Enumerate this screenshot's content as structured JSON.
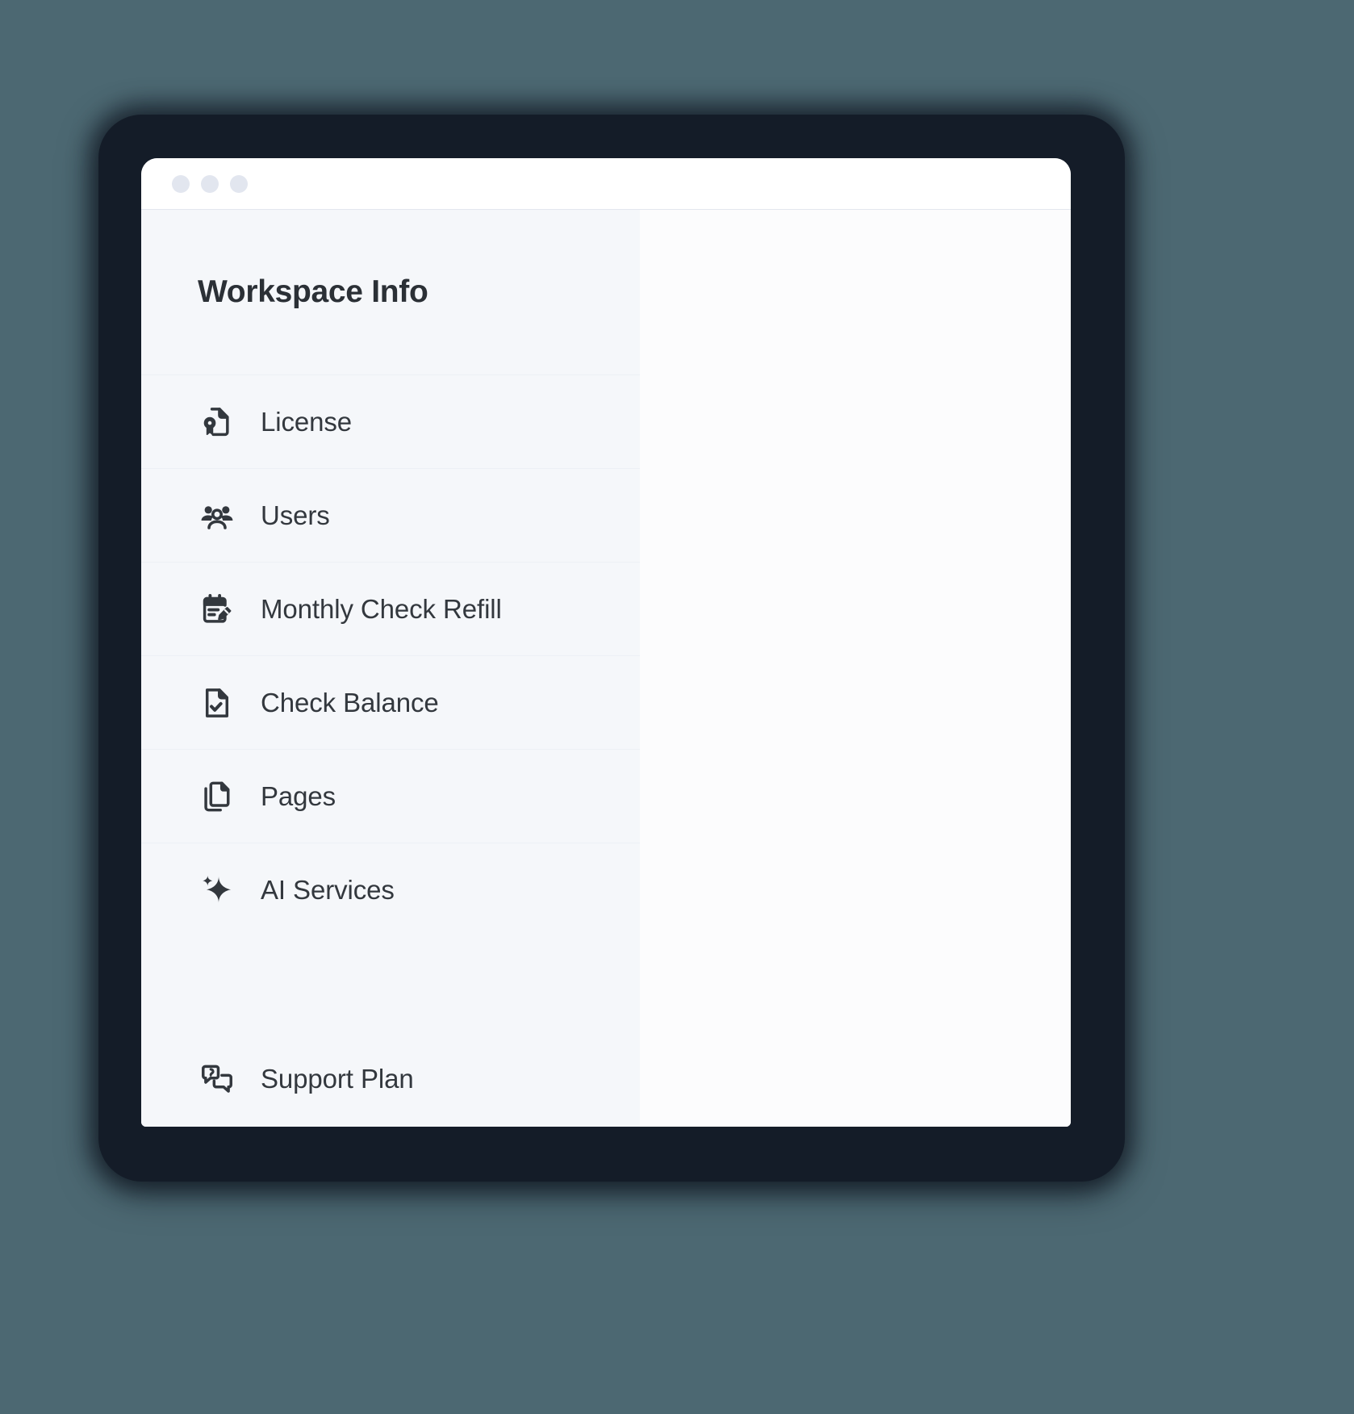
{
  "background_color": "#4C6872",
  "window": {
    "titlebar": {
      "traffic_lights": [
        {
          "name": "close",
          "color": "#E2E6EF"
        },
        {
          "name": "minimize",
          "color": "#E2E6EF"
        },
        {
          "name": "maximize",
          "color": "#E2E6EF"
        }
      ]
    },
    "sidebar": {
      "background_color": "#F5F7FA",
      "title": "Workspace Info",
      "items": [
        {
          "label": "License",
          "icon": "certificate-document-icon"
        },
        {
          "label": "Users",
          "icon": "users-group-icon"
        },
        {
          "label": "Monthly Check Refill",
          "icon": "note-edit-icon"
        },
        {
          "label": "Check Balance",
          "icon": "document-check-icon"
        },
        {
          "label": "Pages",
          "icon": "copy-pages-icon"
        },
        {
          "label": "AI Services",
          "icon": "sparkle-icon"
        },
        {
          "label": "Support Plan",
          "icon": "chat-question-icon"
        }
      ]
    },
    "content": {
      "background_color": "#FCFCFD",
      "body": ""
    }
  }
}
